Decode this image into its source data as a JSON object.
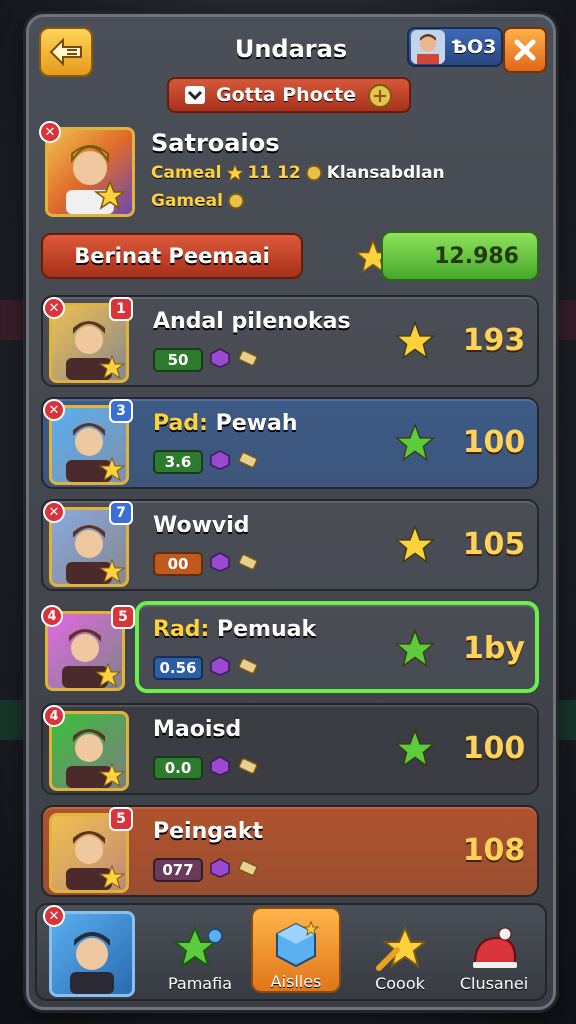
{
  "header": {
    "title": "Undaras",
    "coins": "ѢO3",
    "back_icon": "back-arrow-icon",
    "close_icon": "close-icon"
  },
  "sub_banner": {
    "label": "Gotta Рhocte"
  },
  "player": {
    "name": "Satroaios",
    "stat_prefix": "Cameal",
    "stat_values": "11 12",
    "stat_suffix": "Klansabdlan",
    "sub_text": "Gameal"
  },
  "section": {
    "title": "Berinat Peemaai",
    "progress_text": "12.986",
    "progress_fraction": 0.98
  },
  "rows": [
    {
      "badge": "✕",
      "rank": "1",
      "name_hl": "",
      "name": "Andal pilenokas",
      "chip": "50",
      "chip_color": "#2e7a2e",
      "star_color": "#ffd23c",
      "score": "193",
      "bg": "#4a4d55"
    },
    {
      "badge": "✕",
      "rank": "3",
      "name_hl": "Pad:",
      "name": "Pewah",
      "chip": "3.6",
      "chip_color": "#2e7a2e",
      "star_color": "#5ccc3c",
      "score": "100",
      "bg": "#3c5a86"
    },
    {
      "badge": "✕",
      "rank": "7",
      "name_hl": "",
      "name": "Wowvid",
      "chip": "00",
      "chip_color": "#c05a1c",
      "star_color": "#ffd23c",
      "score": "105",
      "bg": "#4a4d55"
    },
    {
      "badge": "4",
      "rank": "5",
      "name_hl": "Rad:",
      "name": "Pemuak",
      "chip": "0.56",
      "chip_color": "#2a5fa8",
      "star_color": "#5ccc3c",
      "score": "1by",
      "bg": "#4a4d55"
    },
    {
      "badge": "4",
      "rank": "",
      "name_hl": "",
      "name": "Maoisd",
      "chip": "0.0",
      "chip_color": "#2e7a2e",
      "star_color": "#5ccc3c",
      "score": "100",
      "bg": "#3a3c42"
    },
    {
      "badge": "",
      "rank": "5",
      "name_hl": "",
      "name": "Peingakt",
      "chip": "077",
      "chip_color": "#6a3a5a",
      "star_color": "",
      "score": "108",
      "bg": "#b0522c"
    }
  ],
  "nav": {
    "items": [
      {
        "label": "Pamafia",
        "icon": "star-key-icon"
      },
      {
        "label": "Aislles",
        "icon": "cube-icon"
      },
      {
        "label": "Coook",
        "icon": "arrow-star-icon"
      },
      {
        "label": "Clusanei",
        "icon": "helmet-icon"
      }
    ]
  }
}
